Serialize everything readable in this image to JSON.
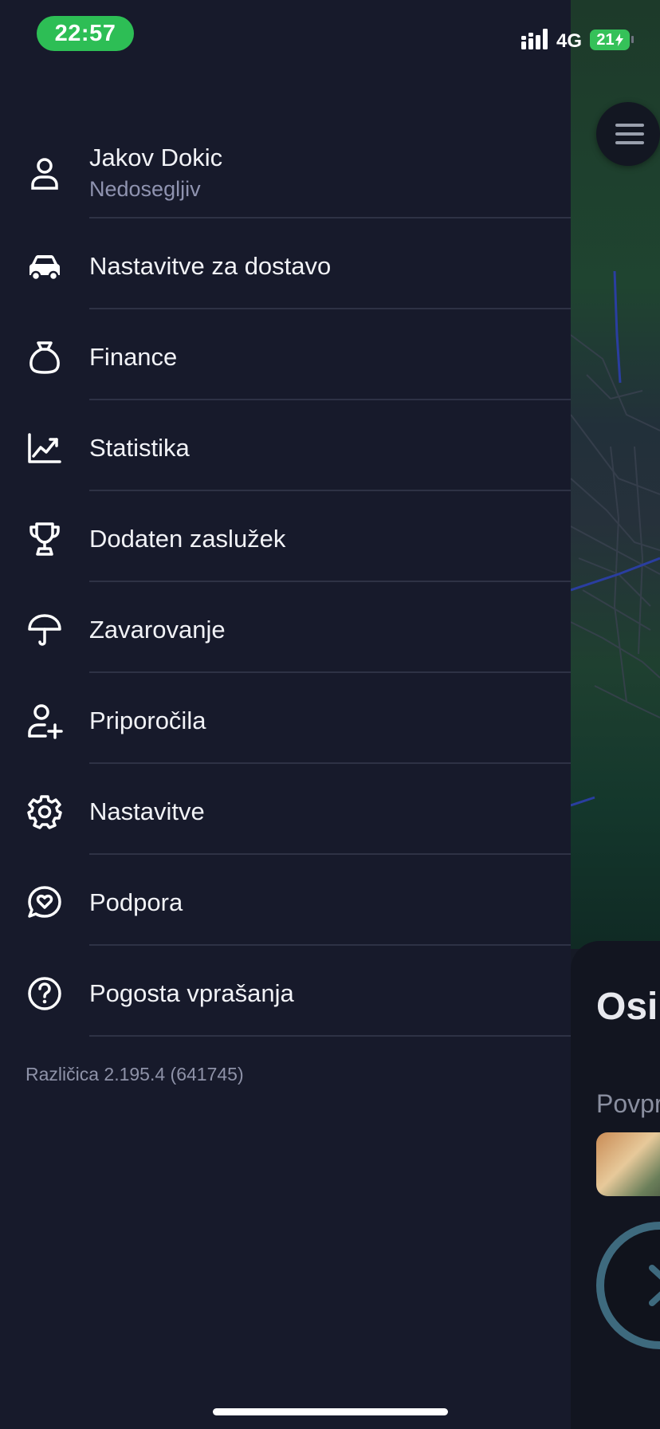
{
  "status_bar": {
    "time": "22:57",
    "network": "4G",
    "battery": "21"
  },
  "drawer": {
    "profile": {
      "name": "Jakov Dokic",
      "status": "Nedosegljiv",
      "icon": "user-icon"
    },
    "items": [
      {
        "label": "Nastavitve za dostavo",
        "icon": "car-icon"
      },
      {
        "label": "Finance",
        "icon": "money-bag-icon"
      },
      {
        "label": "Statistika",
        "icon": "chart-trend-icon"
      },
      {
        "label": "Dodaten zaslužek",
        "icon": "trophy-icon"
      },
      {
        "label": "Zavarovanje",
        "icon": "umbrella-icon"
      },
      {
        "label": "Priporočila",
        "icon": "user-add-icon"
      },
      {
        "label": "Nastavitve",
        "icon": "gear-icon"
      },
      {
        "label": "Podpora",
        "icon": "chat-heart-icon"
      },
      {
        "label": "Pogosta vprašanja",
        "icon": "help-circle-icon"
      }
    ],
    "version": "Različica 2.195.4 (641745)"
  },
  "background_screen": {
    "sheet_title": "Osi",
    "sheet_subtitle": "Povpr"
  },
  "colors": {
    "drawer_bg": "#171a2b",
    "time_pill": "#2dbe55",
    "battery": "#35c159",
    "divider": "#2e3245",
    "secondary_text": "#8f93b0"
  }
}
